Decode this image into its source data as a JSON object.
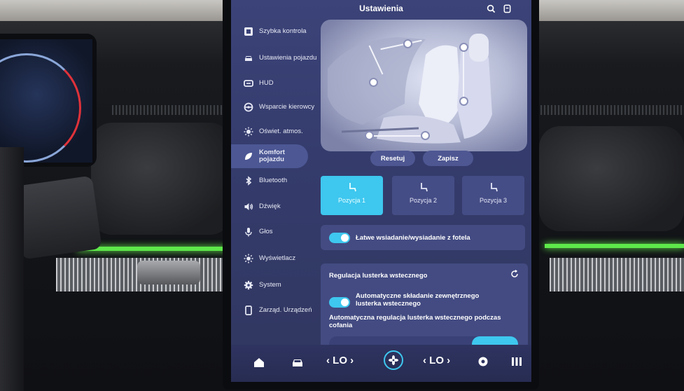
{
  "header": {
    "title": "Ustawienia"
  },
  "sidebar": {
    "items": [
      {
        "label": "Szybka kontrola",
        "icon": "quick-control-icon"
      },
      {
        "label": "Ustawienia pojazdu",
        "icon": "car-icon"
      },
      {
        "label": "HUD",
        "icon": "hud-icon"
      },
      {
        "label": "Wsparcie kierowcy",
        "icon": "steering-wheel-icon"
      },
      {
        "label": "Oświet. atmos.",
        "icon": "sun-icon"
      },
      {
        "label": "Komfort pojazdu",
        "icon": "leaf-icon",
        "active": true
      },
      {
        "label": "Bluetooth",
        "icon": "bluetooth-icon"
      },
      {
        "label": "Dźwięk",
        "icon": "speaker-icon"
      },
      {
        "label": "Głos",
        "icon": "microphone-icon"
      },
      {
        "label": "Wyświetlacz",
        "icon": "brightness-icon"
      },
      {
        "label": "System",
        "icon": "gear-icon"
      },
      {
        "label": "Zarząd. Urządzeń",
        "icon": "device-icon"
      }
    ]
  },
  "seat": {
    "reset_label": "Resetuj",
    "save_label": "Zapisz"
  },
  "positions": [
    {
      "label": "Pozycja 1",
      "number": "1",
      "selected": true
    },
    {
      "label": "Pozycja 2",
      "number": "2",
      "selected": false
    },
    {
      "label": "Pozycja 3",
      "number": "3",
      "selected": false
    }
  ],
  "easy_entry": {
    "label": "Łatwe wsiadanie/wysiadanie z fotela",
    "on": true
  },
  "mirror": {
    "title": "Regulacja lusterka wstecznego",
    "auto_fold_label": "Automatyczne składanie zewnętrznego lusterka wstecznego",
    "auto_fold_on": true,
    "auto_adjust_label": "Automatyczna regulacja lusterka wstecznego podczas cofania"
  },
  "bottom_bar": {
    "left_temp": "LO",
    "right_temp": "LO"
  },
  "colors": {
    "accent": "#3ec7ef",
    "screen_bg": "#3b4378",
    "card_bg": "#434b82"
  }
}
